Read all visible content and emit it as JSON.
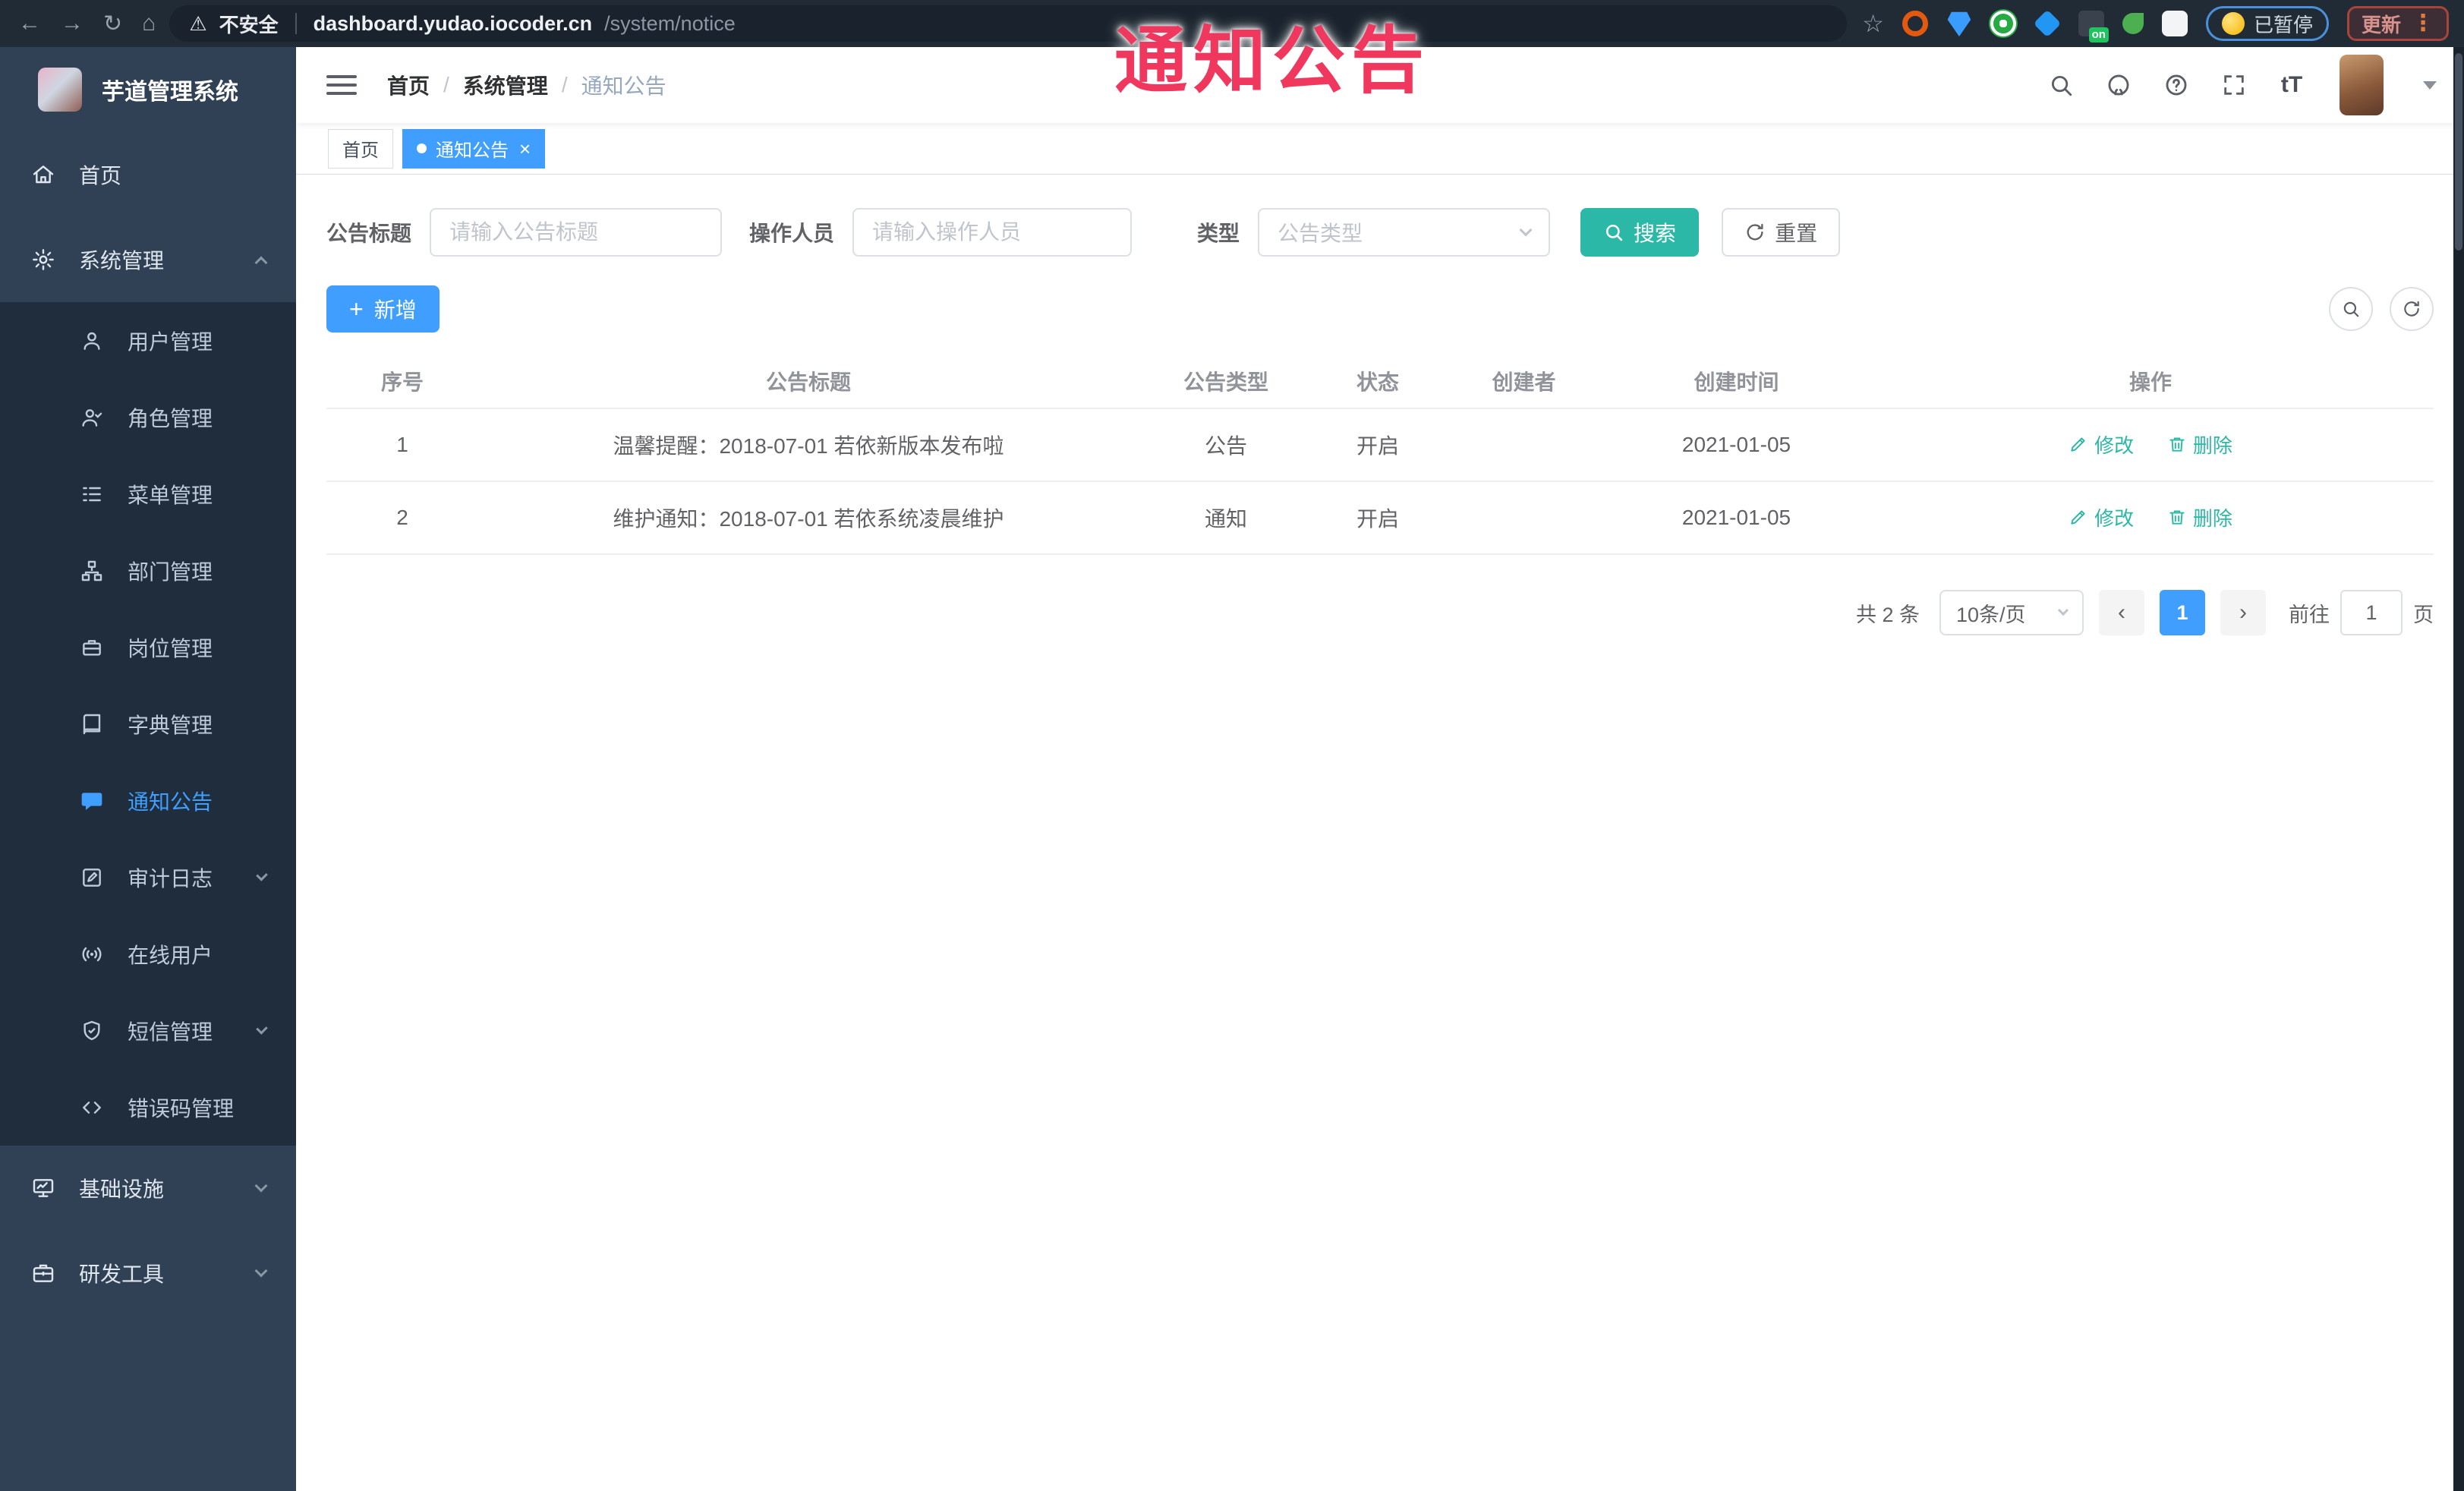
{
  "annotation": {
    "text": "通知公告"
  },
  "browser": {
    "security": "不安全",
    "url_host": "dashboard.yudao.iocoder.cn",
    "url_path": "/system/notice",
    "ext_on_badge": "on",
    "paused_label": "已暂停",
    "update_label": "更新"
  },
  "sidebar": {
    "app_title": "芋道管理系统",
    "home": {
      "label": "首页"
    },
    "system": {
      "label": "系统管理"
    },
    "system_children": [
      {
        "label": "用户管理"
      },
      {
        "label": "角色管理"
      },
      {
        "label": "菜单管理"
      },
      {
        "label": "部门管理"
      },
      {
        "label": "岗位管理"
      },
      {
        "label": "字典管理"
      },
      {
        "label": "通知公告"
      },
      {
        "label": "审计日志"
      },
      {
        "label": "在线用户"
      },
      {
        "label": "短信管理"
      },
      {
        "label": "错误码管理"
      }
    ],
    "infra": {
      "label": "基础设施"
    },
    "devtools": {
      "label": "研发工具"
    }
  },
  "header": {
    "breadcrumb": [
      "首页",
      "系统管理",
      "通知公告"
    ],
    "separator": "/",
    "font_size_label": "tT"
  },
  "tags": [
    {
      "label": "首页"
    },
    {
      "label": "通知公告"
    }
  ],
  "filters": {
    "title_label": "公告标题",
    "title_placeholder": "请输入公告标题",
    "operator_label": "操作人员",
    "operator_placeholder": "请输入操作人员",
    "type_label": "类型",
    "type_placeholder": "公告类型",
    "search_label": "搜索",
    "reset_label": "重置"
  },
  "toolbar": {
    "add_label": "新增"
  },
  "table": {
    "columns": [
      "序号",
      "公告标题",
      "公告类型",
      "状态",
      "创建者",
      "创建时间",
      "操作"
    ],
    "rows": [
      {
        "index": "1",
        "title": "温馨提醒：2018-07-01 若依新版本发布啦",
        "type": "公告",
        "status": "开启",
        "creator": "",
        "created": "2021-01-05"
      },
      {
        "index": "2",
        "title": "维护通知：2018-07-01 若依系统凌晨维护",
        "type": "通知",
        "status": "开启",
        "creator": "",
        "created": "2021-01-05"
      }
    ],
    "actions": {
      "edit": "修改",
      "delete": "删除"
    }
  },
  "pagination": {
    "total": "共 2 条",
    "page_size": "10条/页",
    "prev": "‹",
    "next": "›",
    "current_page": "1",
    "goto_label": "前往",
    "goto_value": "1",
    "page_unit": "页"
  },
  "colors": {
    "primary": "#409eff",
    "search_teal": "#2bb8a7",
    "annotation_red": "#f0375e",
    "sidebar_bg": "#304156",
    "submenu_bg": "#1f2d3d"
  }
}
